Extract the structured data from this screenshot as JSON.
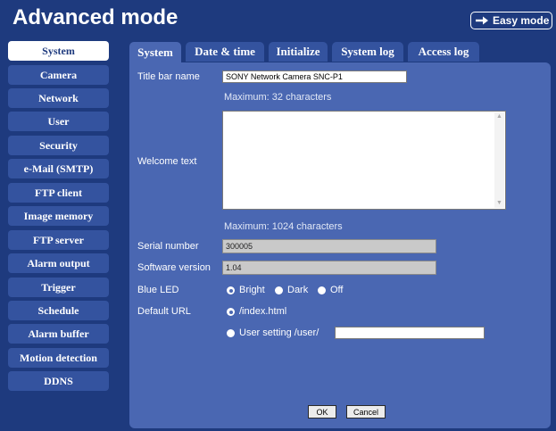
{
  "header": {
    "title": "Advanced mode",
    "easy_mode_label": "Easy mode"
  },
  "sidebar": {
    "items": [
      {
        "label": "System",
        "active": true
      },
      {
        "label": "Camera"
      },
      {
        "label": "Network"
      },
      {
        "label": "User"
      },
      {
        "label": "Security"
      },
      {
        "label": "e-Mail (SMTP)"
      },
      {
        "label": "FTP client"
      },
      {
        "label": "Image memory"
      },
      {
        "label": "FTP server"
      },
      {
        "label": "Alarm output"
      },
      {
        "label": "Trigger"
      },
      {
        "label": "Schedule"
      },
      {
        "label": "Alarm buffer"
      },
      {
        "label": "Motion detection"
      },
      {
        "label": "DDNS"
      }
    ]
  },
  "tabs": [
    {
      "label": "System",
      "active": true
    },
    {
      "label": "Date & time"
    },
    {
      "label": "Initialize"
    },
    {
      "label": "System log"
    },
    {
      "label": "Access log"
    }
  ],
  "form": {
    "title_bar_name": {
      "label": "Title bar name",
      "value": "SONY Network Camera SNC-P1",
      "note": "Maximum: 32 characters"
    },
    "welcome_text": {
      "label": "Welcome text",
      "value": "",
      "note": "Maximum: 1024 characters"
    },
    "serial_number": {
      "label": "Serial number",
      "value": "300005"
    },
    "software_version": {
      "label": "Software version",
      "value": "1.04"
    },
    "blue_led": {
      "label": "Blue LED",
      "options": [
        "Bright",
        "Dark",
        "Off"
      ],
      "selected": "Bright"
    },
    "default_url": {
      "label": "Default URL",
      "option_index": "/index.html",
      "option_user": "User setting /user/",
      "selected": "/index.html",
      "user_value": ""
    }
  },
  "buttons": {
    "ok": "OK",
    "cancel": "Cancel"
  },
  "colors": {
    "nav_bg": "#1e3a7e",
    "item_bg": "#34539f",
    "panel_bg": "#4a67b2"
  }
}
